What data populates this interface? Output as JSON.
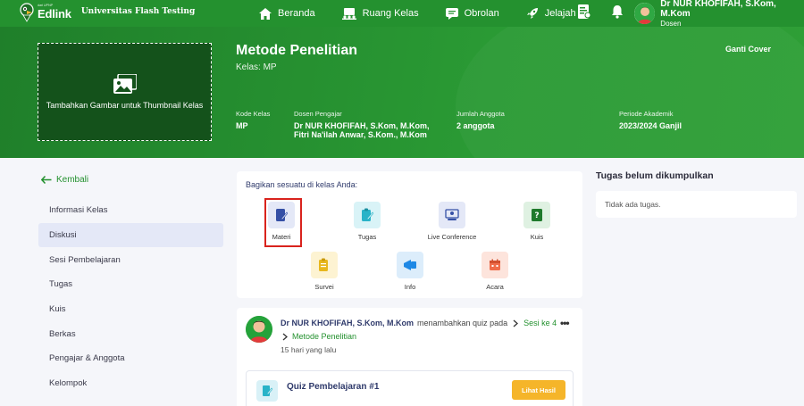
{
  "topbar": {
    "brand_small": "dari UPNP",
    "brand": "Edlink",
    "university": "Universitas Flash Testing",
    "nav": [
      {
        "label": "Beranda",
        "icon": "home-icon"
      },
      {
        "label": "Ruang Kelas",
        "icon": "classroom-icon"
      },
      {
        "label": "Obrolan",
        "icon": "chat-icon"
      },
      {
        "label": "Jelajah",
        "icon": "rocket-icon"
      }
    ],
    "user_name": "Dr NUR KHOFIFAH, S.Kom, M.Kom",
    "user_role": "Dosen"
  },
  "banner": {
    "thumbnail_text": "Tambahkan Gambar untuk Thumbnail Kelas",
    "title": "Metode Penelitian",
    "subtitle": "Kelas: MP",
    "cover_button": "Ganti Cover",
    "meta": [
      {
        "label": "Kode Kelas",
        "value": "MP"
      },
      {
        "label": "Dosen Pengajar",
        "value": "Dr NUR KHOFIFAH, S.Kom, M.Kom, Fitri Na'ilah Anwar, S.Kom., M.Kom"
      },
      {
        "label": "Jumlah Anggota",
        "value": "2 anggota"
      },
      {
        "label": "Periode Akademik",
        "value": "2023/2024 Ganjil"
      }
    ]
  },
  "sidebar": {
    "back": "Kembali",
    "items": [
      {
        "label": "Informasi Kelas"
      },
      {
        "label": "Diskusi"
      },
      {
        "label": "Sesi Pembelajaran"
      },
      {
        "label": "Tugas"
      },
      {
        "label": "Kuis"
      },
      {
        "label": "Berkas"
      },
      {
        "label": "Pengajar & Anggota"
      },
      {
        "label": "Kelompok"
      }
    ],
    "active_index": 1
  },
  "share": {
    "title": "Bagikan sesuatu di kelas Anda:",
    "items": [
      {
        "label": "Materi",
        "icon": "materi-icon",
        "color": "#e4e8f7"
      },
      {
        "label": "Tugas",
        "icon": "tugas-icon",
        "color": "#d9f3f7"
      },
      {
        "label": "Live Conference",
        "icon": "live-conference-icon",
        "color": "#e4e8f7"
      },
      {
        "label": "Kuis",
        "icon": "kuis-icon",
        "color": "#dff1e2"
      },
      {
        "label": "Survei",
        "icon": "survei-icon",
        "color": "#fdf3d2"
      },
      {
        "label": "Info",
        "icon": "info-icon",
        "color": "#dcedfb"
      },
      {
        "label": "Acara",
        "icon": "acara-icon",
        "color": "#fde4dc"
      }
    ]
  },
  "feed": {
    "author": "Dr NUR KHOFIFAH, S.Kom, M.Kom",
    "action": "menambahkan quiz pada",
    "session": "Sesi ke 4",
    "course": "Metode Penelitian",
    "time": "15 hari yang lalu",
    "quiz_title": "Quiz Pembelajaran #1",
    "quiz_button": "Lihat Hasil"
  },
  "todo": {
    "title": "Tugas belum dikumpulkan",
    "empty": "Tidak ada tugas."
  },
  "colors": {
    "brand_green": "#24912f",
    "highlight_red": "#d9231d",
    "button_yellow": "#f5b52a"
  }
}
